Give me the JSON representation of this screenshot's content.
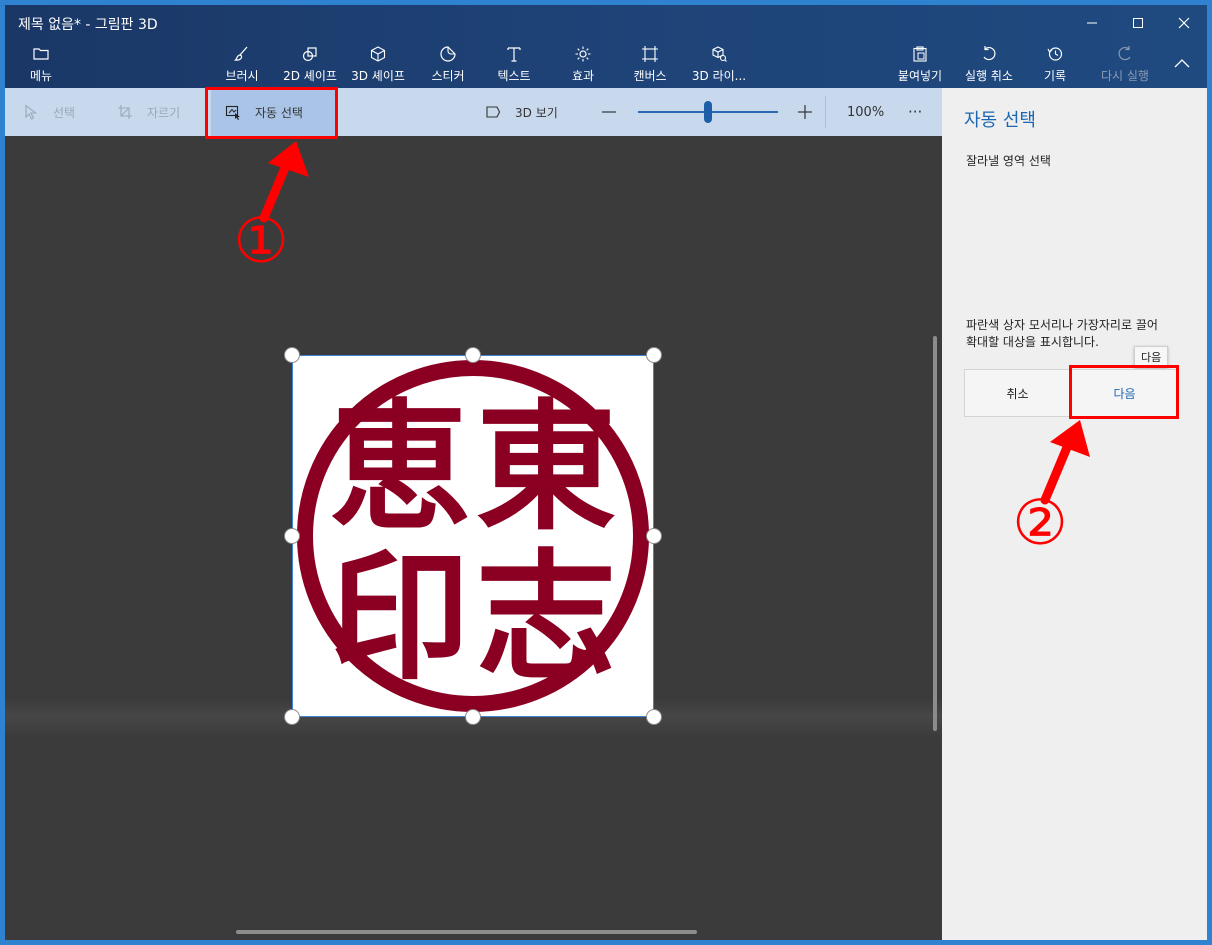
{
  "window": {
    "title": "제목 없음* - 그림판 3D"
  },
  "ribbon": {
    "menu": "메뉴",
    "brushes": "브러시",
    "shapes2d": "2D 셰이프",
    "shapes3d": "3D 셰이프",
    "stickers": "스티커",
    "text": "텍스트",
    "effects": "효과",
    "canvas": "캔버스",
    "library3d": "3D 라이...",
    "paste": "붙여넣기",
    "undo": "실행 취소",
    "history": "기록",
    "redo": "다시 실행"
  },
  "toolbar": {
    "select": "선택",
    "crop": "자르기",
    "magic_select": "자동 선택",
    "view3d": "3D 보기",
    "zoom": "100%",
    "zoom_level": 0.5,
    "more": "···"
  },
  "panel": {
    "title": "자동 선택",
    "subtitle": "잘라낼 영역 선택",
    "desc_line1": "파란색 상자 모서리나 가장자리로 끌어",
    "desc_line2": "확대할 대상을 표시합니다.",
    "cancel": "취소",
    "next": "다음",
    "tooltip": "다음"
  },
  "stamp": {
    "chars": [
      "東",
      "志",
      "恵",
      "印"
    ],
    "color": "#8b0022"
  },
  "annotations": {
    "marker1": "①",
    "marker2": "②",
    "color": "#ff0000"
  }
}
